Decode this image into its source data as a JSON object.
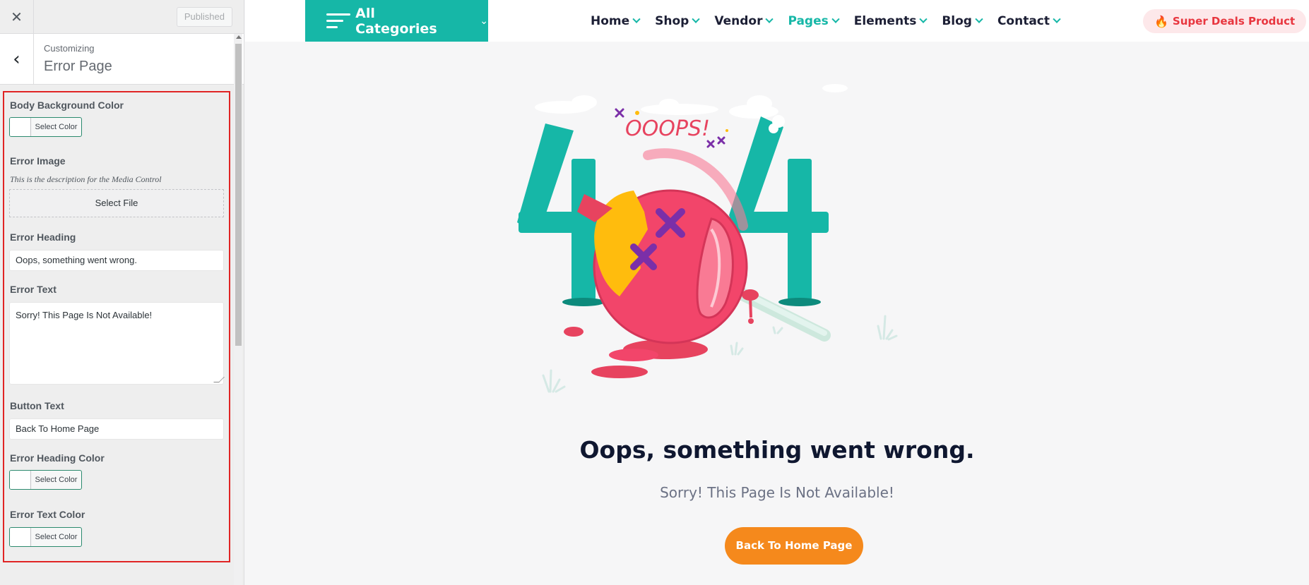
{
  "customizer": {
    "close_icon": "close-icon",
    "published_label": "Published",
    "back_icon": "chevron-left-icon",
    "customizing_label": "Customizing",
    "section_title": "Error Page",
    "controls": {
      "body_bg_label": "Body Background Color",
      "select_color_label": "Select Color",
      "error_image_label": "Error Image",
      "error_image_desc": "This is the description for the Media Control",
      "select_file_label": "Select File",
      "error_heading_label": "Error Heading",
      "error_heading_value": "Oops, something went wrong.",
      "error_text_label": "Error Text",
      "error_text_value": "Sorry! This Page Is Not Available!",
      "button_text_label": "Button Text",
      "button_text_value": "Back To Home Page",
      "heading_color_label": "Error Heading Color",
      "text_color_label": "Error Text Color"
    }
  },
  "site": {
    "all_categories": "All Categories",
    "menu": [
      {
        "label": "Home",
        "active": false
      },
      {
        "label": "Shop",
        "active": false
      },
      {
        "label": "Vendor",
        "active": false
      },
      {
        "label": "Pages",
        "active": true
      },
      {
        "label": "Elements",
        "active": false
      },
      {
        "label": "Blog",
        "active": false
      },
      {
        "label": "Contact",
        "active": false
      }
    ],
    "deals_label": "Super Deals Product",
    "deals_icon": "fire-icon",
    "illustration": {
      "digits": [
        "4",
        "4"
      ],
      "ooops": "OOOPS!"
    },
    "error_heading": "Oops, something went wrong.",
    "error_text": "Sorry! This Page Is Not Available!",
    "home_button": "Back To Home Page"
  },
  "colors": {
    "accent_teal": "#16b7a7",
    "button_orange": "#f5891c",
    "lollipop_pink": "#f2456a",
    "panel_highlight": "#e02424"
  }
}
